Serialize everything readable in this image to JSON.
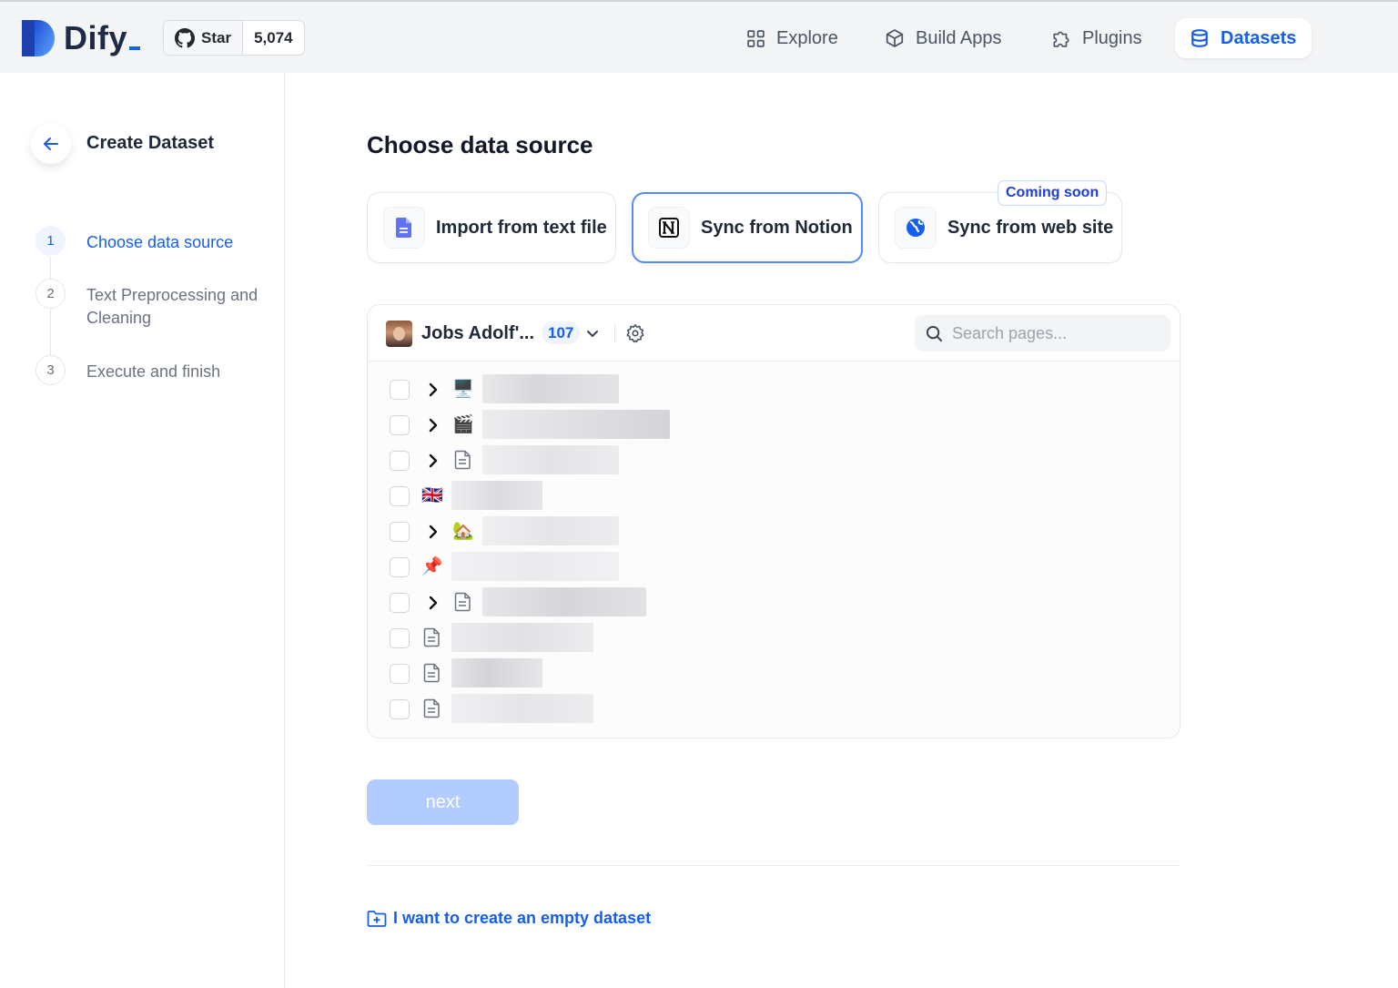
{
  "header": {
    "brand": "Dify",
    "github": {
      "star_label": "Star",
      "count": "5,074"
    },
    "nav": [
      {
        "label": "Explore",
        "icon": "grid-icon"
      },
      {
        "label": "Build Apps",
        "icon": "cube-icon"
      },
      {
        "label": "Plugins",
        "icon": "puzzle-icon"
      },
      {
        "label": "Datasets",
        "icon": "database-icon",
        "active": true
      }
    ]
  },
  "sidebar": {
    "title": "Create Dataset",
    "steps": [
      {
        "num": "1",
        "label": "Choose data source",
        "active": true
      },
      {
        "num": "2",
        "label": "Text Preprocessing and Cleaning",
        "active": false
      },
      {
        "num": "3",
        "label": "Execute and finish",
        "active": false
      }
    ]
  },
  "main": {
    "title": "Choose data source",
    "sources": [
      {
        "label": "Import from text file",
        "icon": "file-icon"
      },
      {
        "label": "Sync from Notion",
        "icon": "notion-icon",
        "selected": true
      },
      {
        "label": "Sync from web site",
        "icon": "globe-icon",
        "badge": "Coming soon"
      }
    ],
    "notion": {
      "workspace_name": "Jobs Adolf'...",
      "page_count": "107",
      "search_placeholder": "Search pages...",
      "pages": [
        {
          "icon": "🖥️",
          "expandable": true
        },
        {
          "icon": "🎬",
          "expandable": true
        },
        {
          "icon": "page-icon",
          "expandable": true
        },
        {
          "icon": "🇬🇧",
          "expandable": false
        },
        {
          "icon": "🏡",
          "expandable": true
        },
        {
          "icon": "📌",
          "expandable": false
        },
        {
          "icon": "page-icon",
          "expandable": true
        },
        {
          "icon": "page-icon",
          "expandable": false
        },
        {
          "icon": "page-icon",
          "expandable": false
        },
        {
          "icon": "page-icon",
          "expandable": false
        }
      ]
    },
    "next_label": "next",
    "empty_dataset_link": "I want to create an empty dataset"
  },
  "colors": {
    "accent": "#155eef",
    "next_disabled": "#b2ccff"
  }
}
